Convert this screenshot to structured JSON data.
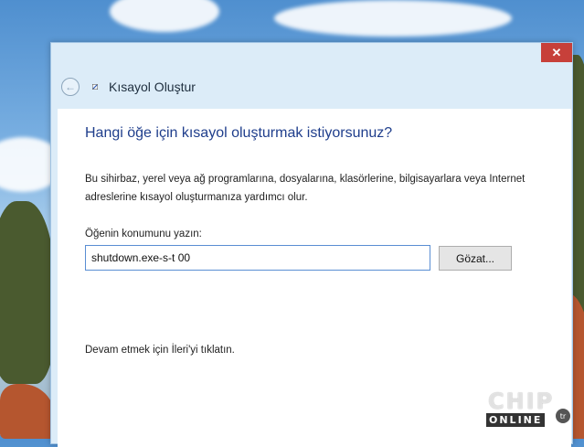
{
  "window": {
    "close_glyph": "✕",
    "back_glyph": "←",
    "title": "Kısayol Oluştur"
  },
  "wizard": {
    "heading": "Hangi öğe için kısayol oluşturmak istiyorsunuz?",
    "description": "Bu sihirbaz, yerel veya ağ programlarına, dosyalarına, klasörlerine, bilgisayarlara veya Internet adreslerine kısayol oluşturmanıza yardımcı olur.",
    "location_label": "Öğenin konumunu yazın:",
    "location_value": "shutdown.exe-s-t 00",
    "browse_label": "Gözat...",
    "hint": "Devam etmek için İleri'yi tıklatın."
  },
  "watermark": {
    "brand": "CHIP",
    "sub": "ONLINE",
    "badge": "tr"
  },
  "colors": {
    "heading": "#1f3e8c",
    "close": "#c7403a",
    "input_border": "#5a8ed3"
  },
  "icons": [
    "close-icon",
    "back-arrow-icon",
    "shortcut-icon"
  ]
}
